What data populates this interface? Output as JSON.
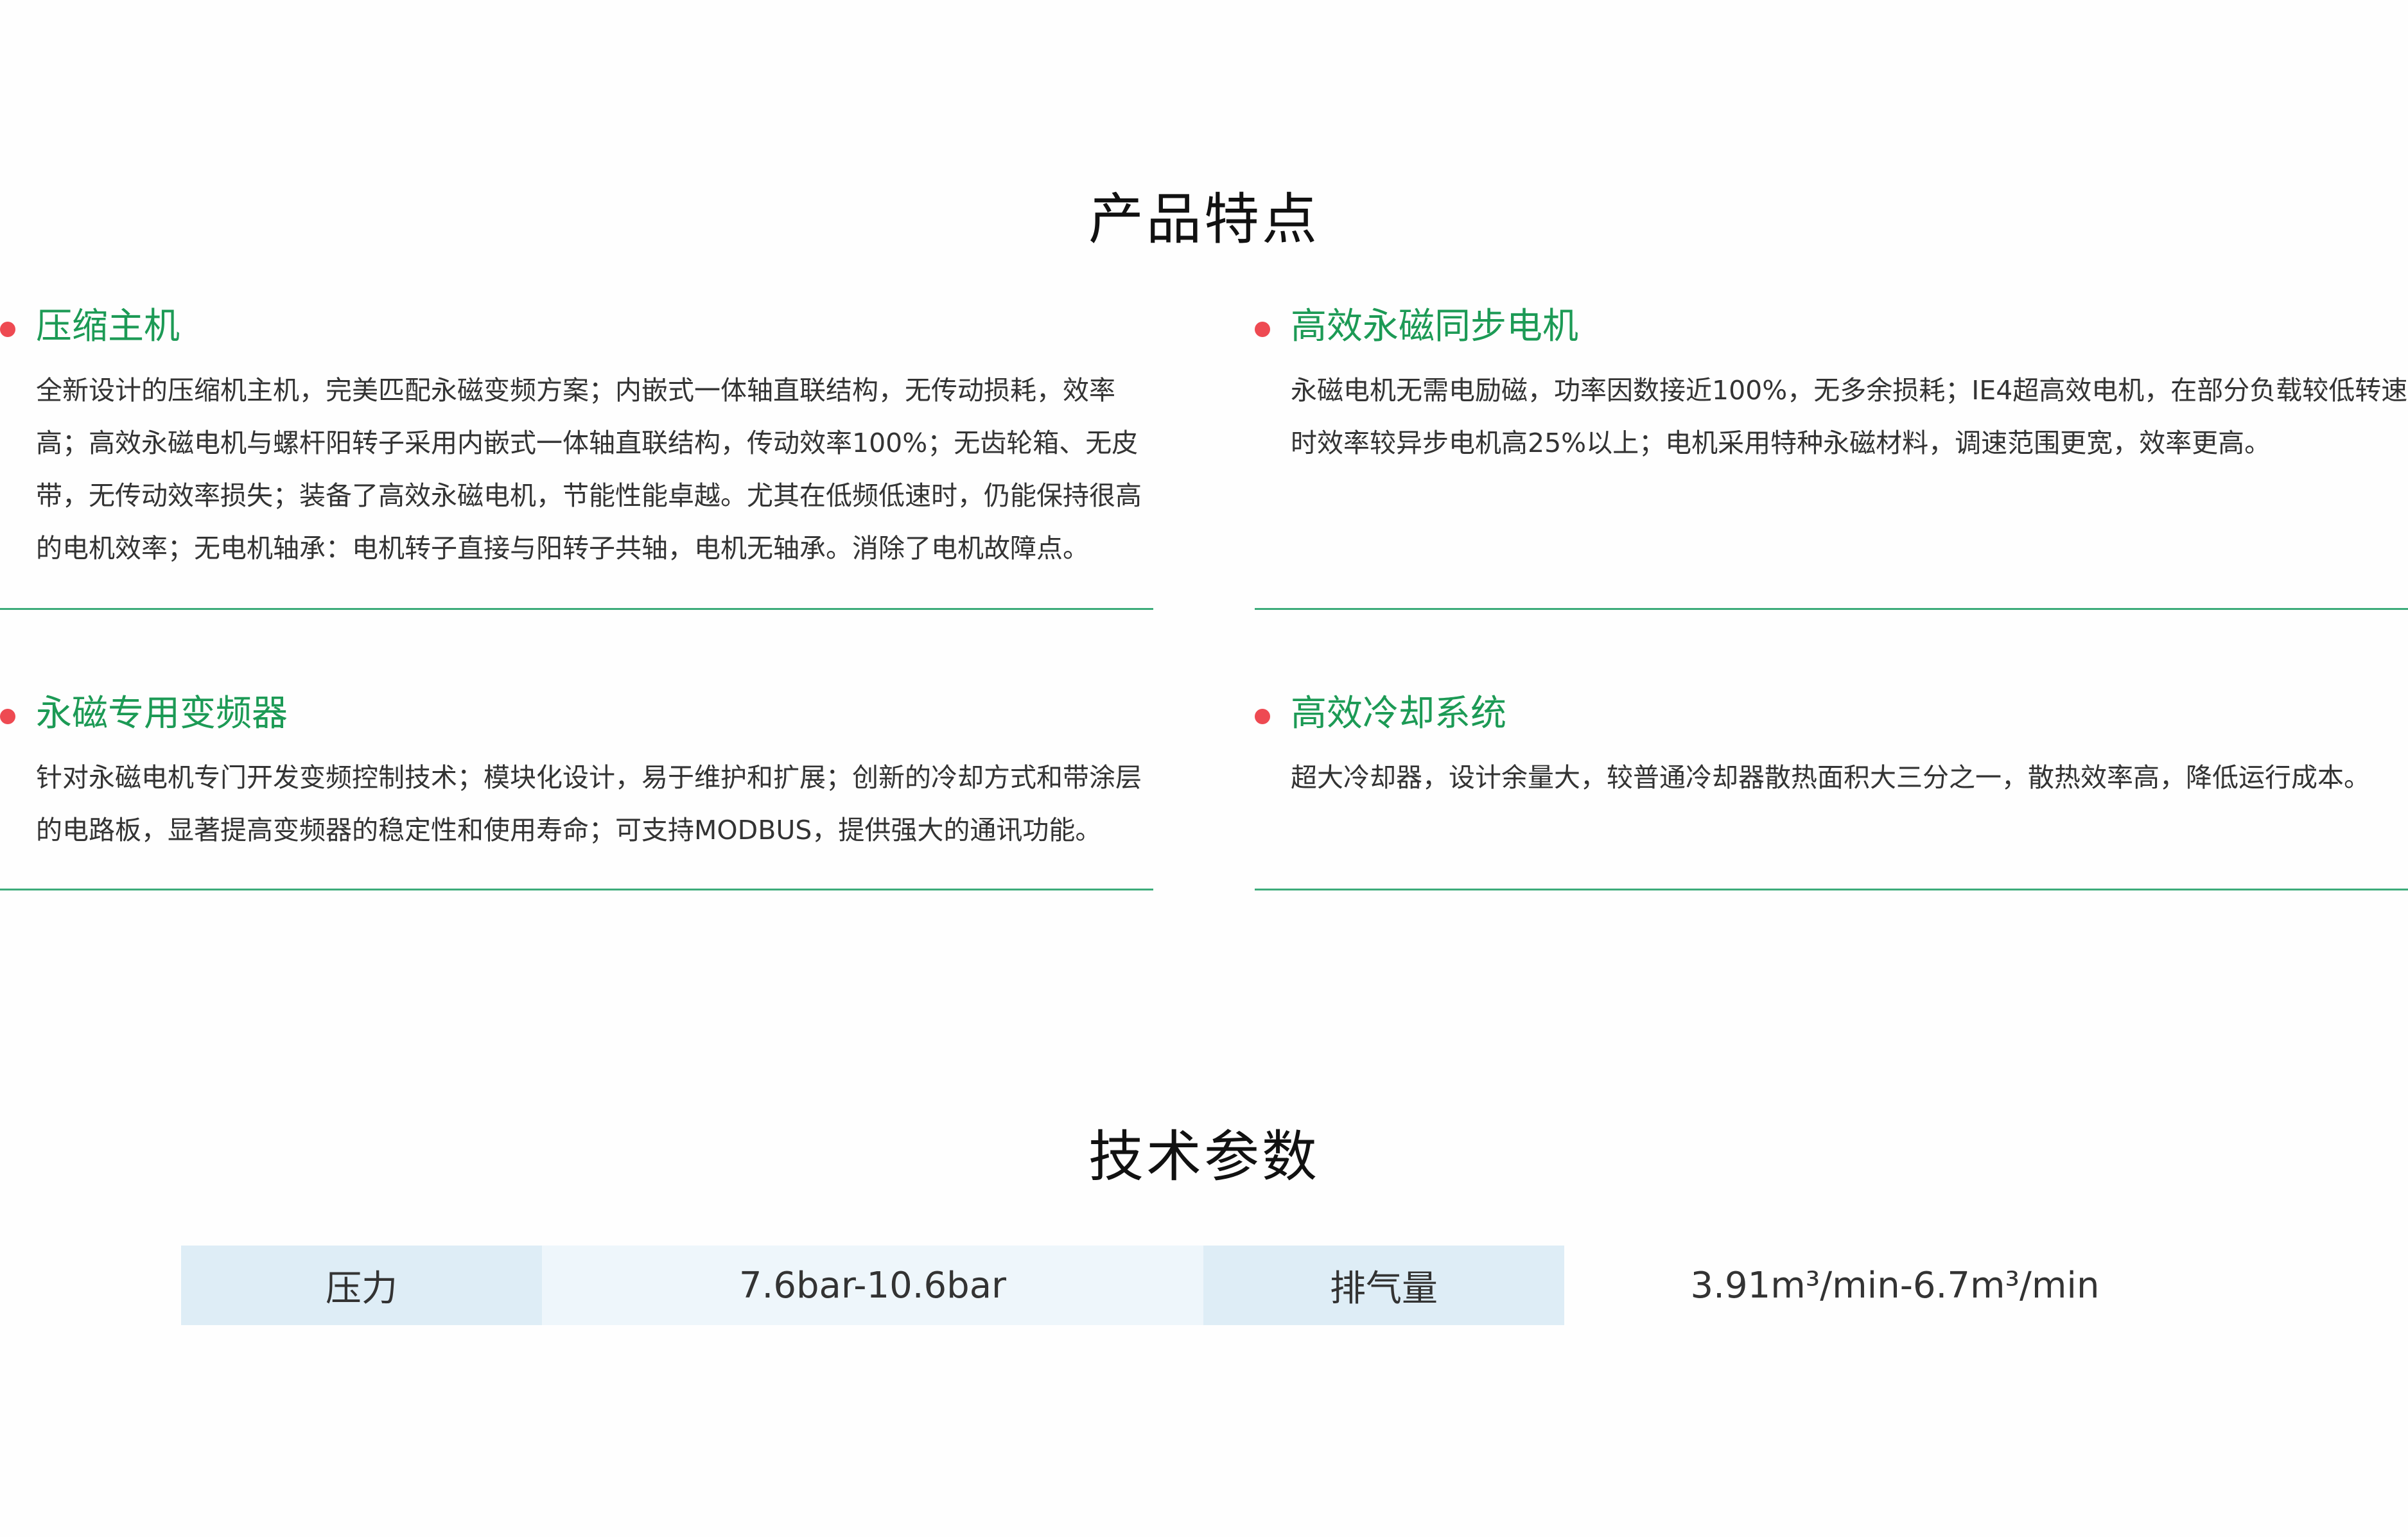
{
  "features": {
    "title": "产品特点",
    "items": [
      {
        "title": "压缩主机",
        "desc": "全新设计的压缩机主机，完美匹配永磁变频方案；内嵌式一体轴直联结构，无传动损耗，效率高；高效永磁电机与螺杆阳转子采用内嵌式一体轴直联结构，传动效率100%；无齿轮箱、无皮带，无传动效率损失；装备了高效永磁电机，节能性能卓越。尤其在低频低速时，仍能保持很高的电机效率；无电机轴承：电机转子直接与阳转子共轴，电机无轴承。消除了电机故障点。"
      },
      {
        "title": "高效永磁同步电机",
        "desc": "永磁电机无需电励磁，功率因数接近100%，无多余损耗；IE4超高效电机，在部分负载较低转速时效率较异步电机高25%以上；电机采用特种永磁材料，调速范围更宽，效率更高。"
      },
      {
        "title": "永磁专用变频器",
        "desc": "针对永磁电机专门开发变频控制技术；模块化设计，易于维护和扩展；创新的冷却方式和带涂层的电路板，显著提高变频器的稳定性和使用寿命；可支持MODBUS，提供强大的通讯功能。"
      },
      {
        "title": "高效冷却系统",
        "desc": "超大冷却器，设计余量大，较普通冷却器散热面积大三分之一，散热效率高，降低运行成本。"
      }
    ]
  },
  "params": {
    "title": "技术参数",
    "pressure_label": "压力",
    "pressure_value": "7.6bar-10.6bar",
    "flow_label": "排气量",
    "flow_value": "3.91m³/min-6.7m³/min"
  },
  "colors": {
    "accent_green": "#1c9a55",
    "divider_green": "#3cab7a",
    "bullet_red": "#ee4a52",
    "label_bg": "#deedf6",
    "value_bg": "#eef6fb"
  }
}
